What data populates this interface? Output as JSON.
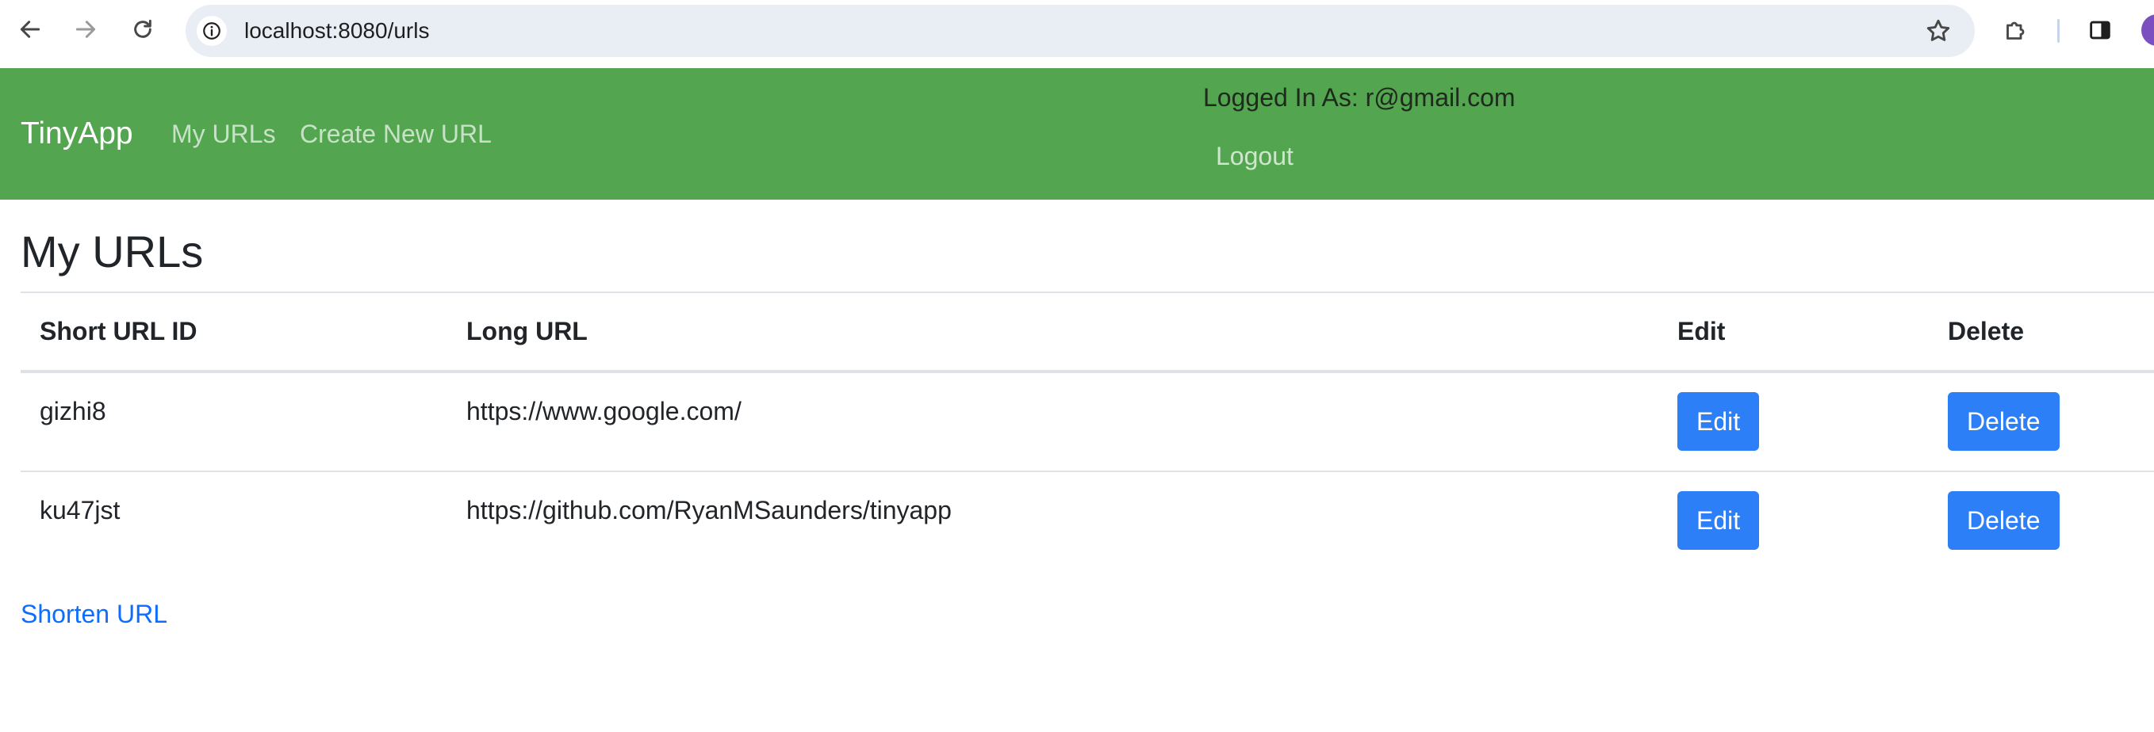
{
  "browser": {
    "url": "localhost:8080/urls",
    "icons": {
      "back": "arrow-left-icon",
      "forward": "arrow-right-icon",
      "reload": "reload-icon",
      "site_info": "info-icon",
      "bookmark": "star-icon",
      "extensions": "puzzle-icon",
      "side_panel": "side-panel-icon"
    },
    "profile_color": "#7b4fc0"
  },
  "navbar": {
    "brand": "TinyApp",
    "links": [
      "My URLs",
      "Create New URL"
    ],
    "logged_in_text": "Logged In As: r@gmail.com",
    "logout": "Logout",
    "background": "#53a54f"
  },
  "main": {
    "title": "My URLs",
    "table": {
      "headers": [
        "Short URL ID",
        "Long URL",
        "Edit",
        "Delete"
      ],
      "rows": [
        {
          "id": "gizhi8",
          "long_url": "https://www.google.com/",
          "edit": "Edit",
          "delete": "Delete"
        },
        {
          "id": "ku47jst",
          "long_url": "https://github.com/RyanMSaunders/tinyapp",
          "edit": "Edit",
          "delete": "Delete"
        }
      ]
    },
    "shorten_link": "Shorten URL",
    "button_color": "#2c7ff7",
    "link_color": "#0d6efd"
  }
}
